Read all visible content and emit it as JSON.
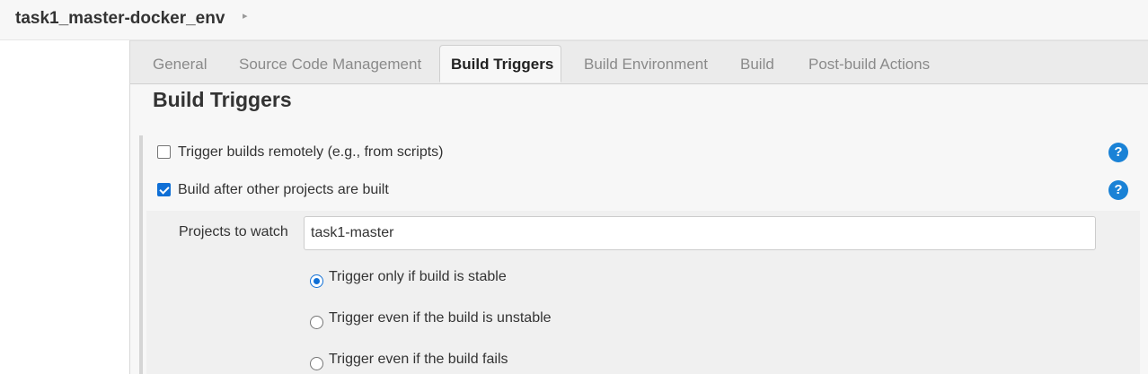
{
  "breadcrumb": {
    "job_name": "task1_master-docker_env",
    "chevron_icon": "chevron-right-icon"
  },
  "tabs": [
    {
      "label": "General",
      "active": false
    },
    {
      "label": "Source Code Management",
      "active": false
    },
    {
      "label": "Build Triggers",
      "active": true
    },
    {
      "label": "Build Environment",
      "active": false
    },
    {
      "label": "Build",
      "active": false
    },
    {
      "label": "Post-build Actions",
      "active": false
    }
  ],
  "section": {
    "title": "Build Triggers"
  },
  "triggers": {
    "remote": {
      "label": "Trigger builds remotely (e.g., from scripts)",
      "checked": false,
      "help_icon": "?"
    },
    "after_other": {
      "label": "Build after other projects are built",
      "checked": true,
      "help_icon": "?"
    }
  },
  "after_other_config": {
    "projects_label": "Projects to watch",
    "projects_value": "task1-master",
    "options": [
      {
        "label": "Trigger only if build is stable",
        "selected": true
      },
      {
        "label": "Trigger even if the build is unstable",
        "selected": false
      },
      {
        "label": "Trigger even if the build fails",
        "selected": false
      }
    ]
  },
  "colors": {
    "accent": "#1a82d6",
    "checkbox_checked": "#0f6fd6"
  }
}
